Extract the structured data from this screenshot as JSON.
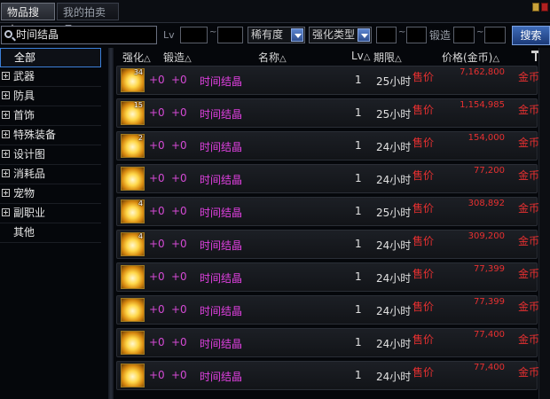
{
  "tabs": [
    "物品搜索",
    "我的拍卖品"
  ],
  "search": {
    "value": "时间结晶"
  },
  "filters": {
    "lv_label": "Lv",
    "rarity_label": "稀有度",
    "upgrade_type_label": "强化类型",
    "forge_label": "锻造",
    "tilde": "~",
    "search_button": "搜索"
  },
  "categories": [
    {
      "label": "全部"
    },
    {
      "label": "武器"
    },
    {
      "label": "防具"
    },
    {
      "label": "首饰"
    },
    {
      "label": "特殊装备"
    },
    {
      "label": "设计图"
    },
    {
      "label": "消耗品"
    },
    {
      "label": "宠物"
    },
    {
      "label": "副职业"
    },
    {
      "label": "其他"
    }
  ],
  "columns": {
    "upgrade": "强化",
    "forge": "锻造",
    "name": "名称",
    "lv": "Lv",
    "expire": "期限",
    "price": "价格(金币)",
    "sort_marker": "△"
  },
  "listings": [
    {
      "stack": "34",
      "upgrade": "+0",
      "forge": "+0",
      "name": "时间结晶",
      "lv": "1",
      "expire": "25小时",
      "sell": "售价",
      "price": "7,162,800",
      "currency": "金币"
    },
    {
      "stack": "15",
      "upgrade": "+0",
      "forge": "+0",
      "name": "时间结晶",
      "lv": "1",
      "expire": "25小时",
      "sell": "售价",
      "price": "1,154,985",
      "currency": "金币"
    },
    {
      "stack": "2",
      "upgrade": "+0",
      "forge": "+0",
      "name": "时间结晶",
      "lv": "1",
      "expire": "24小时",
      "sell": "售价",
      "price": "154,000",
      "currency": "金币"
    },
    {
      "stack": "",
      "upgrade": "+0",
      "forge": "+0",
      "name": "时间结晶",
      "lv": "1",
      "expire": "24小时",
      "sell": "售价",
      "price": "77,200",
      "currency": "金币"
    },
    {
      "stack": "4",
      "upgrade": "+0",
      "forge": "+0",
      "name": "时间结晶",
      "lv": "1",
      "expire": "25小时",
      "sell": "售价",
      "price": "308,892",
      "currency": "金币"
    },
    {
      "stack": "4",
      "upgrade": "+0",
      "forge": "+0",
      "name": "时间结晶",
      "lv": "1",
      "expire": "24小时",
      "sell": "售价",
      "price": "309,200",
      "currency": "金币"
    },
    {
      "stack": "",
      "upgrade": "+0",
      "forge": "+0",
      "name": "时间结晶",
      "lv": "1",
      "expire": "24小时",
      "sell": "售价",
      "price": "77,399",
      "currency": "金币"
    },
    {
      "stack": "",
      "upgrade": "+0",
      "forge": "+0",
      "name": "时间结晶",
      "lv": "1",
      "expire": "24小时",
      "sell": "售价",
      "price": "77,399",
      "currency": "金币"
    },
    {
      "stack": "",
      "upgrade": "+0",
      "forge": "+0",
      "name": "时间结晶",
      "lv": "1",
      "expire": "24小时",
      "sell": "售价",
      "price": "77,400",
      "currency": "金币"
    },
    {
      "stack": "",
      "upgrade": "+0",
      "forge": "+0",
      "name": "时间结晶",
      "lv": "1",
      "expire": "24小时",
      "sell": "售价",
      "price": "77,400",
      "currency": "金币"
    }
  ]
}
